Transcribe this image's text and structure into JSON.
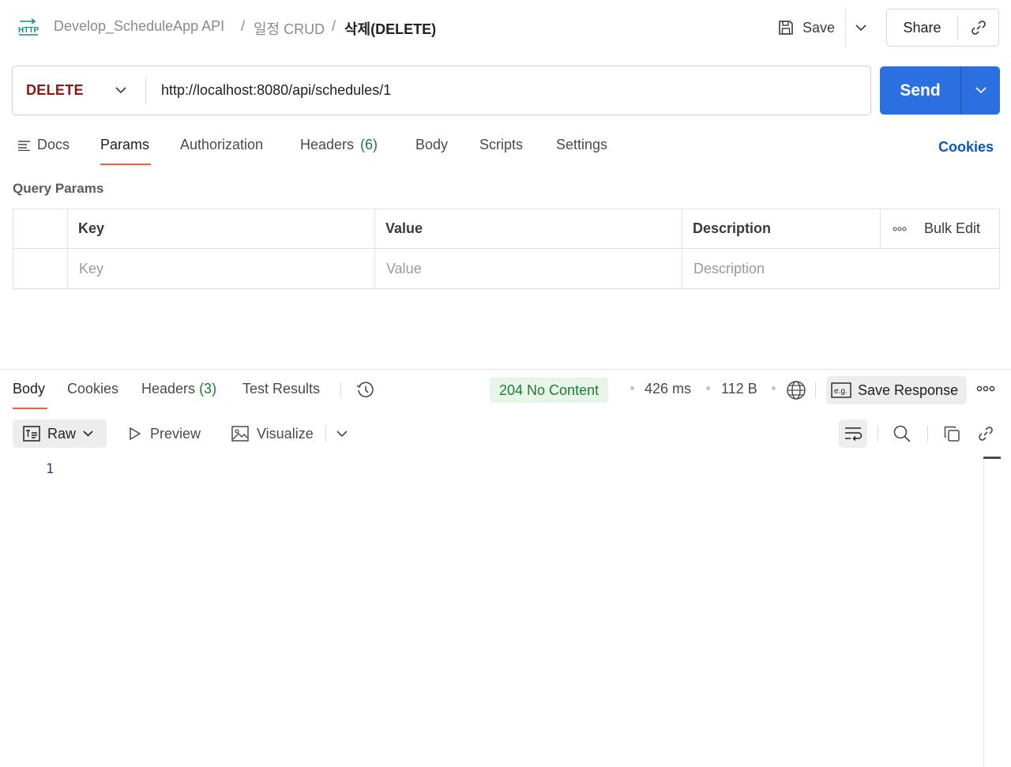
{
  "header": {
    "icon": "http-request-icon",
    "breadcrumb": [
      "Develop_ScheduleApp API",
      "일정 CRUD"
    ],
    "separator": "/",
    "current": "삭제(DELETE)",
    "save_label": "Save",
    "share_label": "Share"
  },
  "request": {
    "method": "DELETE",
    "method_color": "#8b1a10",
    "url": "http://localhost:8080/api/schedules/1",
    "send_label": "Send",
    "send_color": "#2b6fe0"
  },
  "request_tabs": {
    "docs": "Docs",
    "params": "Params",
    "authorization": "Authorization",
    "headers": "Headers",
    "headers_count": "(6)",
    "body": "Body",
    "scripts": "Scripts",
    "settings": "Settings",
    "active": "Params",
    "cookies": "Cookies"
  },
  "query_params": {
    "title": "Query Params",
    "columns": {
      "key": "Key",
      "value": "Value",
      "description": "Description"
    },
    "bulk_edit": "Bulk Edit",
    "placeholders": {
      "key": "Key",
      "value": "Value",
      "description": "Description"
    }
  },
  "response": {
    "tabs": {
      "body": "Body",
      "cookies": "Cookies",
      "headers": "Headers",
      "headers_count": "(3)",
      "test_results": "Test Results",
      "active": "Body"
    },
    "status": "204 No Content",
    "status_color": "#1e7b34",
    "time": "426 ms",
    "size": "112 B",
    "save_response": "Save Response",
    "format": "Raw",
    "preview": "Preview",
    "visualize": "Visualize",
    "line_numbers": [
      "1"
    ]
  }
}
